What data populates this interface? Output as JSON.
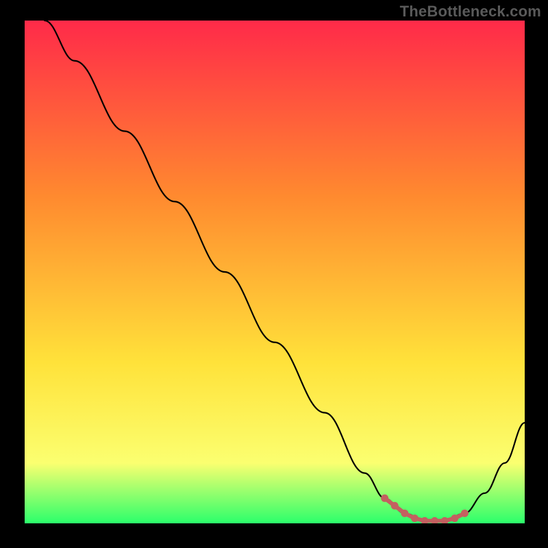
{
  "attribution": "TheBottleneck.com",
  "colors": {
    "background": "#000000",
    "gradient_top": "#ff2a49",
    "gradient_mid1": "#ff8a2f",
    "gradient_mid2": "#ffe23a",
    "gradient_mid3": "#fbff70",
    "gradient_bottom": "#2bff6b",
    "curve": "#000000",
    "flat_segment": "#c36060",
    "attribution_text": "#5a5a5a"
  },
  "chart_data": {
    "type": "line",
    "title": "",
    "xlabel": "",
    "ylabel": "",
    "xlim": [
      0,
      100
    ],
    "ylim": [
      0,
      100
    ],
    "series": [
      {
        "name": "bottleneck-curve",
        "x": [
          4,
          10,
          20,
          30,
          40,
          50,
          60,
          68,
          72,
          76,
          80,
          84,
          88,
          92,
          96,
          100
        ],
        "y": [
          100,
          92,
          78,
          64,
          50,
          36,
          22,
          10,
          5,
          2,
          0.5,
          0.5,
          2,
          6,
          12,
          20
        ]
      }
    ],
    "flat_segment": {
      "name": "optimal-range",
      "x": [
        72,
        74,
        76,
        78,
        80,
        82,
        84,
        86,
        88
      ],
      "y": [
        5,
        3.5,
        2,
        1,
        0.5,
        0.5,
        0.5,
        1,
        2
      ]
    },
    "legend": []
  }
}
